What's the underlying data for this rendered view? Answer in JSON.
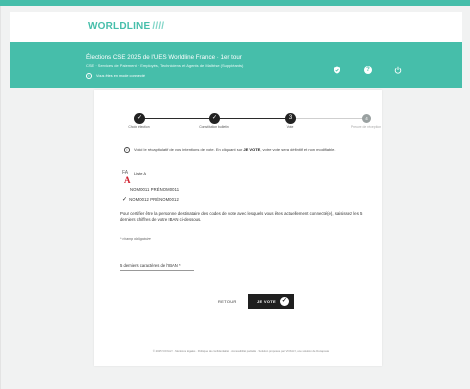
{
  "brand": {
    "name": "WORLDLINE",
    "mark": "////"
  },
  "hero": {
    "title": "Élections CSE 2025 de l'UES Worldline France · 1er tour",
    "subtitle": "CSE · Services de Paiement · Employés, Techniciens et Agents de Maîtrise (Suppléants)",
    "info": "Vous êtes en mode connecté",
    "icons": [
      "shield-icon",
      "help-icon",
      "power-icon"
    ]
  },
  "stepper": {
    "steps": [
      {
        "num": "1",
        "label": "Choix élection",
        "state": "done",
        "mark": "✓"
      },
      {
        "num": "2",
        "label": "Constitution bulletin",
        "state": "done",
        "mark": "✓"
      },
      {
        "num": "3",
        "label": "Vote",
        "state": "current",
        "mark": "3"
      },
      {
        "num": "4",
        "label": "Preuve de réception",
        "state": "pending",
        "mark": "4"
      }
    ]
  },
  "notice": {
    "prefix": "Voici le récapitulatif de vos intentions de vote. En cliquant sur",
    "strong": "JE VOTE",
    "suffix": ", votre vote sera définitif et non modifiable."
  },
  "ballot": {
    "list_logo": "FA",
    "list_letter": "A",
    "list_name": "Liste A",
    "candidates": [
      {
        "name": "NOM0011 PRÉNOM0011",
        "checked": false
      },
      {
        "name": "NOM0012 PRÉNOM0012",
        "checked": true
      }
    ],
    "check_mark": "✓"
  },
  "certify_text": "Pour certifier être la personne destinataire des codes de vote avec lesquels vous êtes actuellement connecté(e), saisissez les 5 derniers chiffres de votre IBAN ci-dessous.",
  "required_text": "* champ obligatoire",
  "iban": {
    "label": "5 derniers caractères de l'IBAN *",
    "value": ""
  },
  "actions": {
    "back": "RETOUR",
    "vote": "JE VOTE",
    "vote_icon": "✓"
  },
  "footer": "© 2025 VOXALY · Mentions légales · Politique de confidentialité · Accessibilité partielle · Solution proposée par VOXALY, une solution de Docaposte",
  "colors": {
    "primary": "#46beaa",
    "dark": "#1f1f1f",
    "accent": "#d01f2e"
  }
}
